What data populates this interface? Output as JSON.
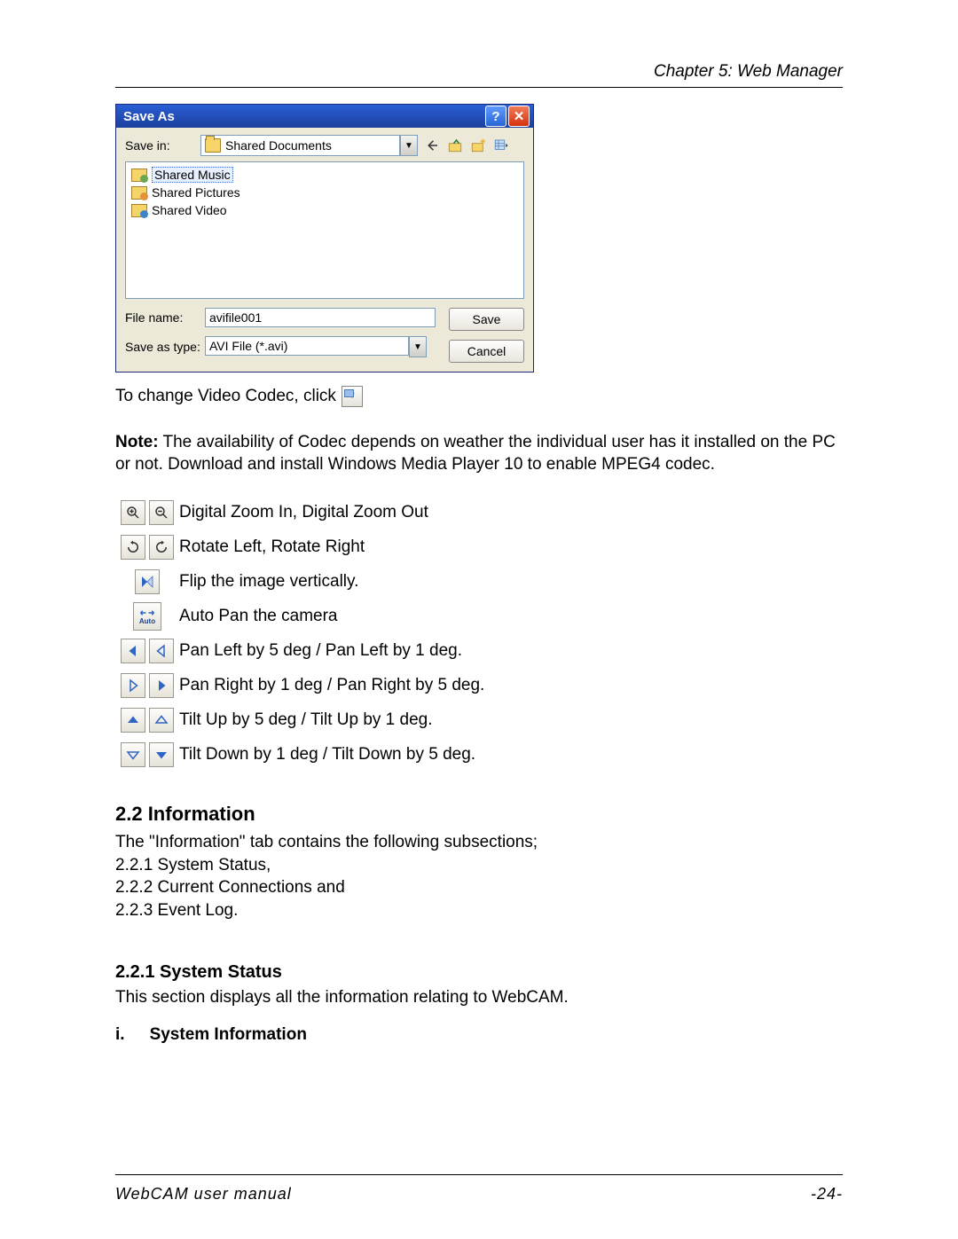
{
  "header": {
    "chapter": "Chapter 5: Web Manager"
  },
  "saveas": {
    "title": "Save As",
    "save_in_label": "Save in:",
    "save_in_value": "Shared Documents",
    "files": [
      {
        "name": "Shared Music",
        "selected": true,
        "badge": "music"
      },
      {
        "name": "Shared Pictures",
        "selected": false,
        "badge": "pic"
      },
      {
        "name": "Shared Video",
        "selected": false,
        "badge": "vid"
      }
    ],
    "filename_label": "File name:",
    "filename_value": "avifile001",
    "type_label": "Save as type:",
    "type_value": "AVI File (*.avi)",
    "save_btn": "Save",
    "cancel_btn": "Cancel"
  },
  "codec_para": "To change Video Codec, click",
  "note_label": "Note:",
  "note_text": " The availability of Codec depends on weather the individual user has it installed on the PC or not. Download and install Windows Media Player 10 to enable MPEG4 codec.",
  "icon_rows": [
    "Digital Zoom In, Digital Zoom Out",
    "Rotate Left, Rotate Right",
    "Flip the image vertically.",
    "Auto Pan the camera",
    "Pan Left by 5 deg / Pan Left by 1 deg.",
    "Pan Right by 1 deg / Pan Right by 5 deg.",
    "Tilt Up by 5 deg / Tilt Up by 1 deg.",
    "Tilt Down by 1 deg / Tilt Down by 5 deg."
  ],
  "auto_label": "Auto",
  "section_22": "2.2 Information",
  "section_22_text": {
    "l1": "The \"Information\" tab contains the following subsections;",
    "l2": "2.2.1 System Status,",
    "l3": "2.2.2 Current Connections and",
    "l4": "2.2.3 Event Log."
  },
  "section_221": "2.2.1 System Status",
  "section_221_text": "This section displays all the information relating to WebCAM.",
  "section_i_prefix": "i.",
  "section_i": "System Information",
  "footer": {
    "left": "WebCAM user manual",
    "right": "-24-"
  }
}
